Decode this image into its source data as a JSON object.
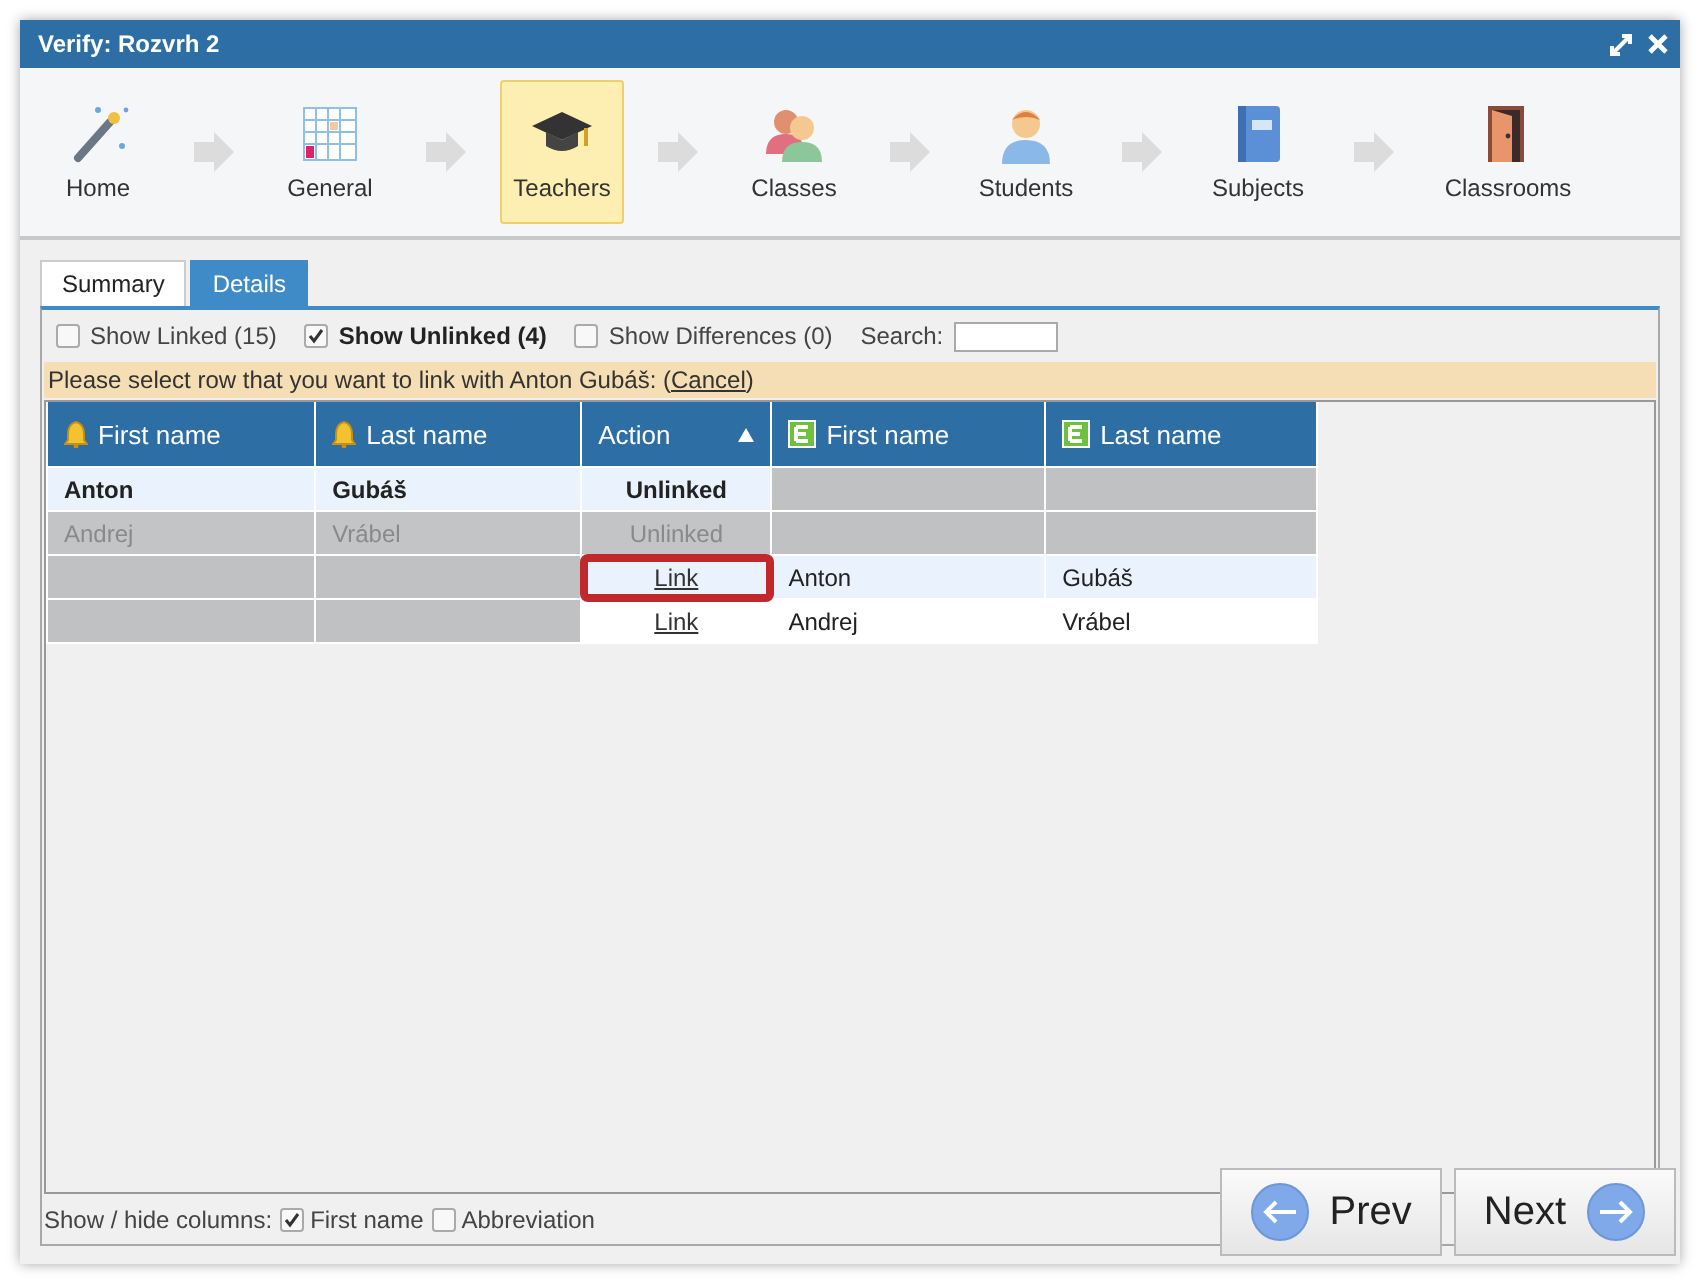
{
  "window": {
    "title": "Verify: Rozvrh 2"
  },
  "steps": [
    {
      "label": "Home",
      "selected": false
    },
    {
      "label": "General",
      "selected": false
    },
    {
      "label": "Teachers",
      "selected": true
    },
    {
      "label": "Classes",
      "selected": false
    },
    {
      "label": "Students",
      "selected": false
    },
    {
      "label": "Subjects",
      "selected": false
    },
    {
      "label": "Classrooms",
      "selected": false
    }
  ],
  "tabs": [
    {
      "label": "Summary",
      "selected": false
    },
    {
      "label": "Details",
      "selected": true
    }
  ],
  "filters": [
    {
      "label": "Show Linked (15)",
      "checked": false
    },
    {
      "label": "Show Unlinked (4)",
      "checked": true
    },
    {
      "label": "Show Differences (0)",
      "checked": false
    }
  ],
  "search": {
    "label": "Search:"
  },
  "notice": {
    "prefix": "Please select row that you want to link with Anton Gubáš: (",
    "link": "Cancel",
    "suffix": ")"
  },
  "table": {
    "columns": [
      {
        "label": "First name",
        "kind": "bell",
        "sorted": false
      },
      {
        "label": "Last name",
        "kind": "bell",
        "sorted": false
      },
      {
        "label": "Action",
        "kind": "action",
        "sorted": true
      },
      {
        "label": "First name",
        "kind": "e",
        "sorted": false
      },
      {
        "label": "Last name",
        "kind": "e",
        "sorted": false
      }
    ],
    "rows": [
      {
        "selected": true,
        "disabled": false,
        "outlined": false,
        "cells": [
          "Anton",
          "Gubáš",
          "Unlinked",
          null,
          null
        ]
      },
      {
        "selected": false,
        "disabled": true,
        "outlined": false,
        "cells": [
          "Andrej",
          "Vrábel",
          "Unlinked",
          null,
          null
        ]
      },
      {
        "selected": true,
        "disabled": false,
        "outlined": true,
        "cells": [
          null,
          null,
          "Link",
          "Anton",
          "Gubáš"
        ]
      },
      {
        "selected": false,
        "disabled": false,
        "outlined": false,
        "cells": [
          null,
          null,
          "Link",
          "Andrej",
          "Vrábel"
        ]
      }
    ]
  },
  "footer": {
    "label": "Show / hide columns:",
    "options": [
      {
        "label": "First name",
        "checked": true
      },
      {
        "label": "Abbreviation",
        "checked": false
      }
    ]
  },
  "buttons": [
    {
      "label": "Prev",
      "kind": "prev"
    },
    {
      "label": "Next",
      "kind": "next"
    }
  ]
}
